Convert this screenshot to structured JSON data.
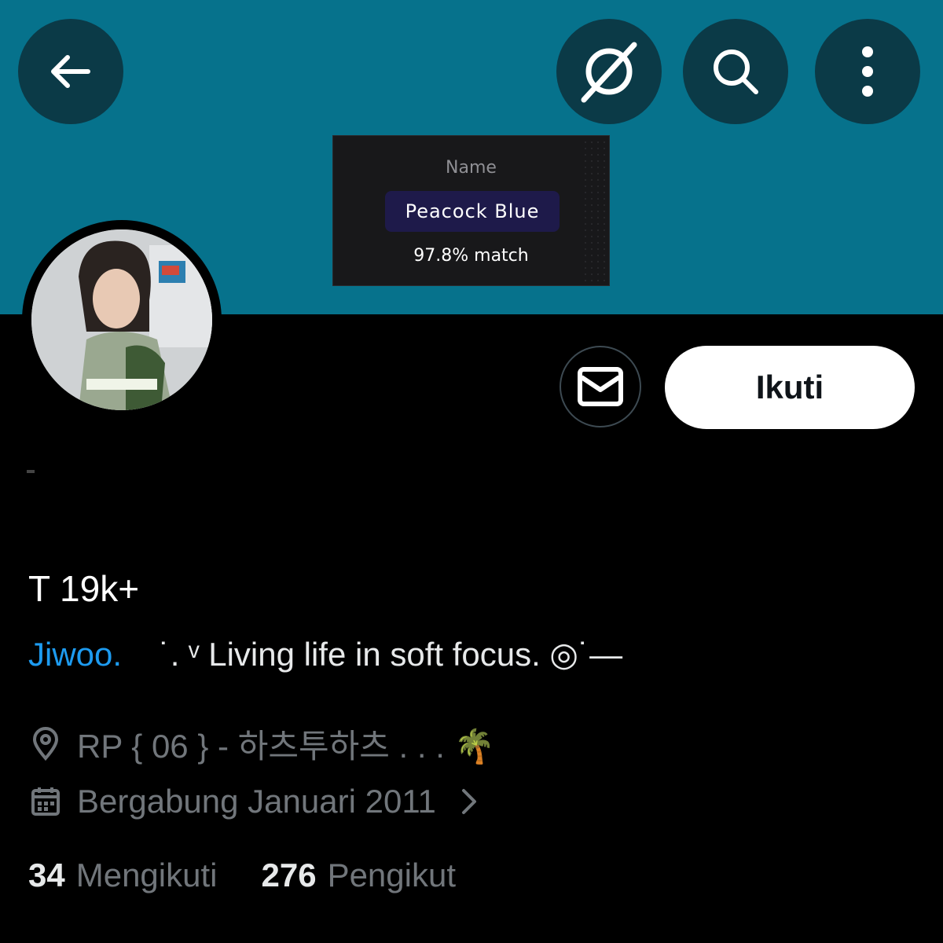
{
  "colors": {
    "banner": "#06728c",
    "header_button_bg": "#0b3a47",
    "mention": "#1d9bf0",
    "muted_text": "#71767b",
    "swatch_pill": "#1e1a4a"
  },
  "header": {
    "back_icon": "arrow-left-icon",
    "grok_icon": "grok-icon",
    "search_icon": "search-icon",
    "more_icon": "more-vertical-icon"
  },
  "color_overlay": {
    "label": "Name",
    "color_name": "Peacock Blue",
    "match": "97.8% match"
  },
  "profile": {
    "display_name": "T 19k+",
    "bio_mention": "Jiwoo.",
    "bio_text": "˙. ᵛ Living life in soft focus. ◎˙—",
    "location": "RP { 06 } - 하츠투하츠 . . . 🌴",
    "joined": "Bergabung Januari 2011",
    "following_count": "34",
    "following_label": "Mengikuti",
    "followers_count": "276",
    "followers_label": "Pengikut"
  },
  "actions": {
    "message_icon": "mail-icon",
    "follow_label": "Ikuti"
  }
}
